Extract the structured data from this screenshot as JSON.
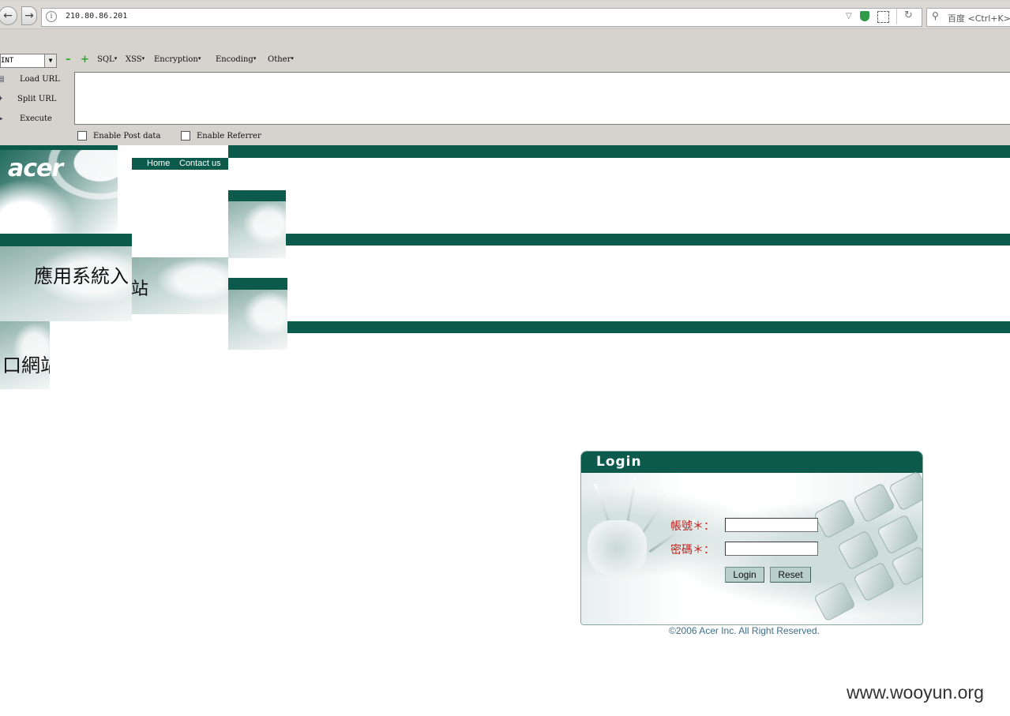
{
  "browser": {
    "url": "210.80.86.201",
    "search_placeholder": "百度 <Ctrl+K>"
  },
  "hackbar": {
    "db_select": "INT",
    "menus": [
      "SQL",
      "XSS",
      "Encryption",
      "Encoding",
      "Other"
    ],
    "buttons": {
      "load": "Load URL",
      "split": "Split URL",
      "execute": "Execute"
    },
    "url_value": "",
    "checkboxes": {
      "post": "Enable Post data",
      "referrer": "Enable Referrer"
    }
  },
  "page": {
    "logo": "acer",
    "nav": {
      "home": "Home",
      "contact": "Contact us"
    },
    "title_part1": "應用系統入",
    "title_part2": "站",
    "title_part3": "口網站"
  },
  "login": {
    "title": "Login",
    "username_label": "帳號＊：",
    "password_label": "密碼＊：",
    "login_button": "Login",
    "reset_button": "Reset",
    "copyright": "©2006 Acer Inc. All Right Reserved."
  },
  "watermark": "www.wooyun.org",
  "colors": {
    "brand_green": "#0c5a4c",
    "label_red": "#c0201e"
  }
}
